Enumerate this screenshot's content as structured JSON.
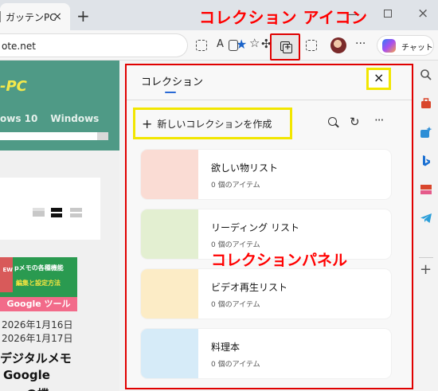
{
  "browser": {
    "tab_title": "ガッテンPC",
    "tab_close": "×",
    "new_tab": "+",
    "window_min": "—",
    "window_close": "×",
    "address": "ote.net",
    "copilot_label": "チャット",
    "more": "···",
    "reader_aa": "A"
  },
  "callouts": {
    "collections_icon": "コレクション アイコン",
    "collections_panel": "コレクションパネル"
  },
  "website": {
    "logo": "-PC",
    "nav": [
      "ows 10",
      "Windows"
    ],
    "thumbnail": {
      "badge": "EW",
      "line1": "pメモの各種機能",
      "line2": "編集と設定方法",
      "footer": "Google ツール"
    },
    "date1": "2026年1月16日",
    "date2": "2026年1月17日",
    "title_line1": "デジタルメモ",
    "title_line2": "Google",
    "title_line3": "の機"
  },
  "panel": {
    "title": "コレクション",
    "close": "×",
    "new_collection": "新しいコレクションを作成",
    "refresh": "↻",
    "more": "···",
    "collections": [
      {
        "name": "欲しい物リスト",
        "count": "0 個のアイテム",
        "color": "#fadcd4"
      },
      {
        "name": "リーディング リスト",
        "count": "0 個のアイテム",
        "color": "#e3efd1"
      },
      {
        "name": "ビデオ再生リスト",
        "count": "0 個のアイテム",
        "color": "#fcecc6"
      },
      {
        "name": "料理本",
        "count": "0 個のアイテム",
        "color": "#d6ebf8"
      }
    ]
  },
  "sidebar": {
    "icons": [
      "search-icon",
      "tools-icon",
      "games-icon",
      "bing-icon",
      "price-icon",
      "telegram-icon"
    ],
    "add": "+"
  }
}
